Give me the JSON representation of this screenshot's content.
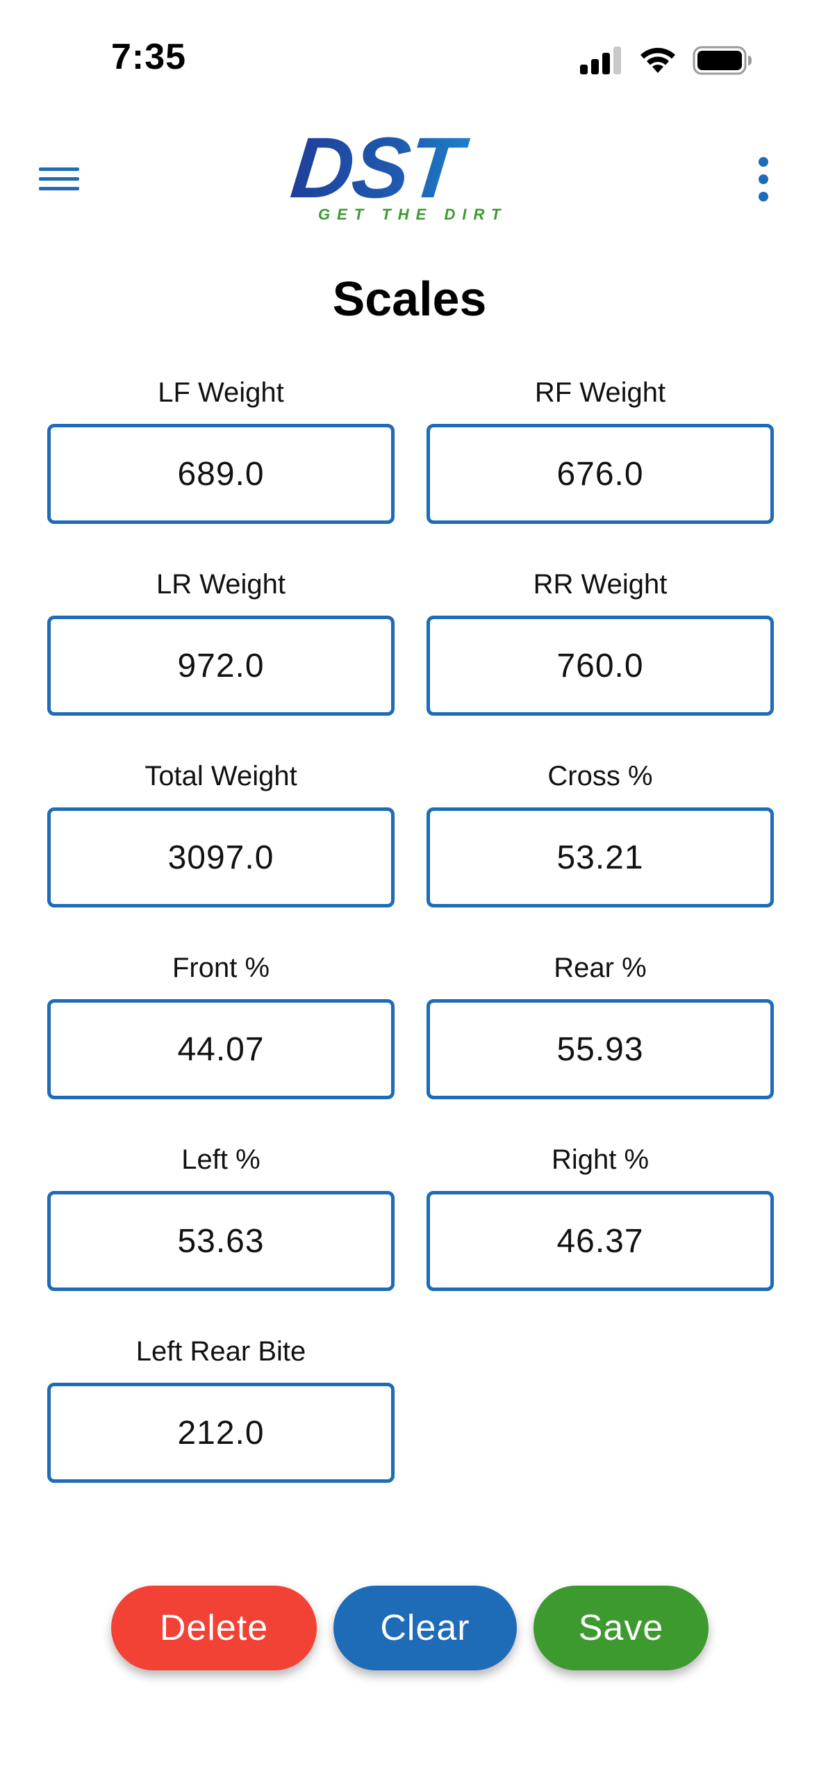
{
  "status_bar": {
    "time": "7:35",
    "icons": [
      "cellular-signal-icon",
      "wifi-icon",
      "battery-icon"
    ]
  },
  "header": {
    "menu_icon": "hamburger-menu-icon",
    "more_icon": "more-vertical-icon",
    "logo": {
      "text": "DST",
      "tagline": "GET THE DIRT"
    }
  },
  "page": {
    "title": "Scales"
  },
  "fields": {
    "lf_weight": {
      "label": "LF Weight",
      "value": "689.0"
    },
    "rf_weight": {
      "label": "RF Weight",
      "value": "676.0"
    },
    "lr_weight": {
      "label": "LR Weight",
      "value": "972.0"
    },
    "rr_weight": {
      "label": "RR Weight",
      "value": "760.0"
    },
    "total_weight": {
      "label": "Total Weight",
      "value": "3097.0"
    },
    "cross_pct": {
      "label": "Cross %",
      "value": "53.21"
    },
    "front_pct": {
      "label": "Front %",
      "value": "44.07"
    },
    "rear_pct": {
      "label": "Rear %",
      "value": "55.93"
    },
    "left_pct": {
      "label": "Left %",
      "value": "53.63"
    },
    "right_pct": {
      "label": "Right %",
      "value": "46.37"
    },
    "left_rear_bite": {
      "label": "Left Rear Bite",
      "value": "212.0"
    }
  },
  "actions": {
    "delete_label": "Delete",
    "clear_label": "Clear",
    "save_label": "Save"
  },
  "colors": {
    "accent_blue": "#1e6bb8",
    "delete_red": "#f14235",
    "save_green": "#3d9a2e",
    "logo_green": "#3a9a2e"
  }
}
